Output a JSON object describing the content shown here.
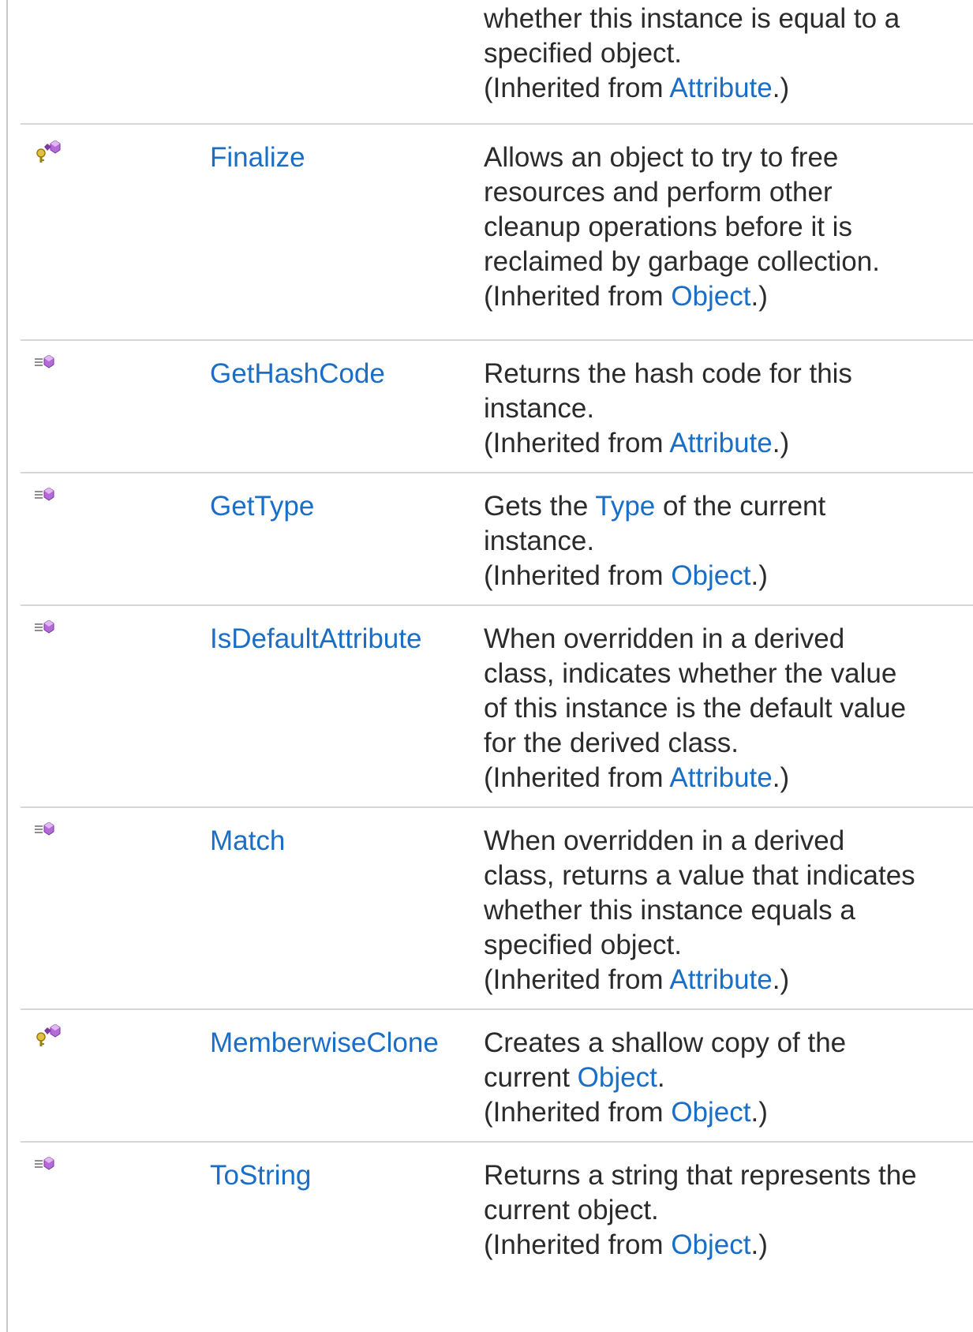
{
  "rows": [
    {
      "id": "equals",
      "name": "",
      "icon": "public-method-icon",
      "desc_lines": [
        "whether this instance is equal to a",
        "specified object."
      ],
      "inherited_prefix": "(Inherited from ",
      "inherited_link": "Attribute",
      "inherited_suffix": ".)"
    },
    {
      "id": "finalize",
      "name": "Finalize",
      "icon": "protected-method-icon",
      "desc_lines": [
        "Allows an object to try to free",
        "resources and perform other",
        "cleanup operations before it is",
        "reclaimed by garbage collection."
      ],
      "inherited_prefix": "(Inherited from ",
      "inherited_link": "Object",
      "inherited_suffix": ".)"
    },
    {
      "id": "gethashcode",
      "name": "GetHashCode",
      "icon": "public-method-icon",
      "desc_lines": [
        "Returns the hash code for this",
        "instance."
      ],
      "inherited_prefix": "(Inherited from ",
      "inherited_link": "Attribute",
      "inherited_suffix": ".)"
    },
    {
      "id": "gettype",
      "name": "GetType",
      "icon": "public-method-icon",
      "desc_first_pre": "Gets the ",
      "desc_first_link": "Type",
      "desc_first_post": " of the current",
      "desc_lines": [
        "instance."
      ],
      "inherited_prefix": "(Inherited from ",
      "inherited_link": "Object",
      "inherited_suffix": ".)"
    },
    {
      "id": "isdefaultattribute",
      "name": "IsDefaultAttribute",
      "icon": "public-method-icon",
      "desc_lines": [
        "When overridden in a derived",
        "class, indicates whether the value",
        "of this instance is the default value",
        "for the derived class."
      ],
      "inherited_prefix": "(Inherited from ",
      "inherited_link": "Attribute",
      "inherited_suffix": ".)"
    },
    {
      "id": "match",
      "name": "Match",
      "icon": "public-method-icon",
      "desc_lines": [
        "When overridden in a derived",
        "class, returns a value that indicates",
        "whether this instance equals a",
        "specified object."
      ],
      "inherited_prefix": "(Inherited from ",
      "inherited_link": "Attribute",
      "inherited_suffix": ".)"
    },
    {
      "id": "memberwiseclone",
      "name": "MemberwiseClone",
      "icon": "protected-method-icon",
      "desc_first": "Creates a shallow copy of the",
      "desc_second_pre": "current ",
      "desc_second_link": "Object",
      "desc_second_post": ".",
      "inherited_prefix": "(Inherited from ",
      "inherited_link": "Object",
      "inherited_suffix": ".)"
    },
    {
      "id": "tostring",
      "name": "ToString",
      "icon": "public-method-icon",
      "desc_lines": [
        "Returns a string that represents the",
        "current object."
      ],
      "inherited_prefix": "(Inherited from ",
      "inherited_link": "Object",
      "inherited_suffix": ".)"
    }
  ],
  "colors": {
    "link": "#1a6ec6",
    "text": "#2b2b2b",
    "divider": "#d7d7d7",
    "icon_purple": "#a14fc4",
    "icon_key": "#d8b020"
  }
}
